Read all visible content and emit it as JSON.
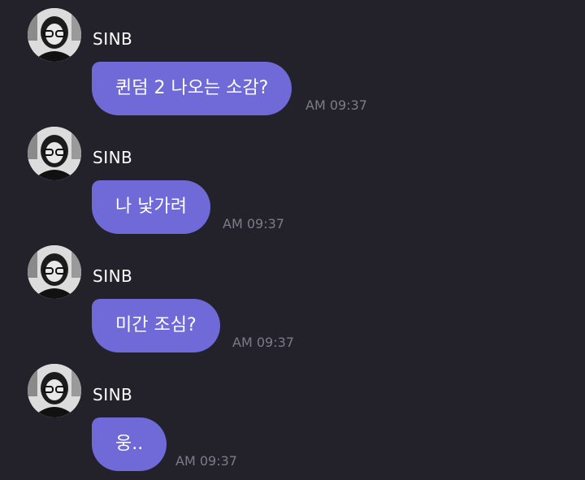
{
  "messages": [
    {
      "sender": "SINB",
      "text": "퀸덤 2 나오는 소감?",
      "time": "AM 09:37"
    },
    {
      "sender": "SINB",
      "text": "나 낯가려",
      "time": "AM 09:37"
    },
    {
      "sender": "SINB",
      "text": "미간 조심?",
      "time": "AM 09:37"
    },
    {
      "sender": "SINB",
      "text": "웅..",
      "time": "AM 09:37"
    }
  ]
}
